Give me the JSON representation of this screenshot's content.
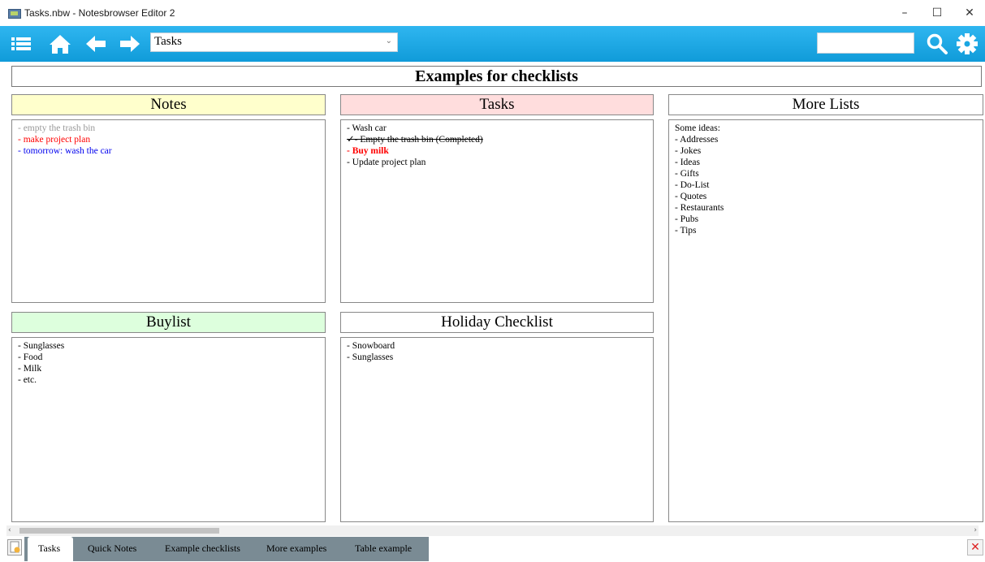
{
  "window": {
    "title": "Tasks.nbw - Notesbrowser Editor 2",
    "controls": {
      "minimize": "–",
      "maximize": "☐",
      "close": "✕"
    }
  },
  "toolbar": {
    "notebook_select": "Tasks",
    "search_value": "",
    "icons": [
      "menu-icon",
      "home-icon",
      "back-arrow-icon",
      "forward-arrow-icon",
      "search-icon",
      "gear-icon"
    ]
  },
  "page": {
    "title": "Examples for checklists"
  },
  "sections": {
    "notes": {
      "title": "Notes",
      "header_color": "#ffffcc",
      "lines": [
        {
          "text": "- empty the trash bin",
          "color": "#999999"
        },
        {
          "text": "- make project plan",
          "color": "#ff0000"
        },
        {
          "text": "- tomorrow: wash the car",
          "color": "#0000ee"
        }
      ]
    },
    "tasks": {
      "title": "Tasks",
      "header_color": "#ffdddd",
      "lines": [
        {
          "text": "- Wash car"
        },
        {
          "text": "✓- Empty the trash bin (Completed)",
          "strike": true
        },
        {
          "text": "- Buy milk",
          "color": "#ff0000",
          "bold": true
        },
        {
          "text": "- Update project plan"
        }
      ]
    },
    "more_lists": {
      "title": "More Lists",
      "lines": [
        {
          "text": "Some ideas:"
        },
        {
          "text": "- Addresses"
        },
        {
          "text": "- Jokes"
        },
        {
          "text": "- Ideas"
        },
        {
          "text": "- Gifts"
        },
        {
          "text": "- Do-List"
        },
        {
          "text": "- Quotes"
        },
        {
          "text": "- Restaurants"
        },
        {
          "text": "- Pubs"
        },
        {
          "text": "- Tips"
        }
      ]
    },
    "buylist": {
      "title": "Buylist",
      "header_color": "#ddffdd",
      "lines": [
        {
          "text": "- Sunglasses"
        },
        {
          "text": "- Food"
        },
        {
          "text": "- Milk"
        },
        {
          "text": "- etc."
        }
      ]
    },
    "holiday": {
      "title": "Holiday Checklist",
      "lines": [
        {
          "text": "- Snowboard"
        },
        {
          "text": "- Sunglasses"
        }
      ]
    }
  },
  "tabs": {
    "active": "Tasks",
    "items": [
      "Tasks",
      "Quick Notes",
      "Example checklists",
      "More examples",
      "Table example"
    ]
  },
  "scrollbar": {
    "left_arrow": "‹",
    "right_arrow": "›"
  }
}
